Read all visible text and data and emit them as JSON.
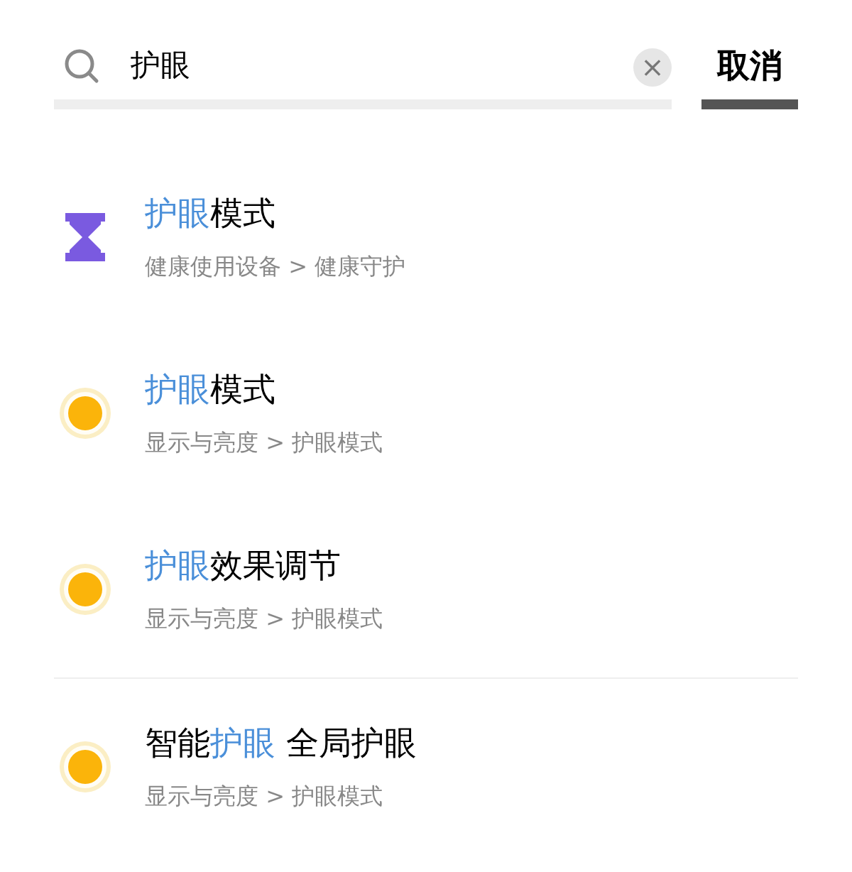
{
  "search": {
    "value": "护眼",
    "clear_label": "×"
  },
  "cancel": "取消",
  "groups": [
    [
      {
        "kind": "hourglass",
        "title": [
          {
            "text": "护眼",
            "match": true
          },
          {
            "text": "模式",
            "match": false
          }
        ],
        "path": "健康使用设备 > 健康守护"
      },
      {
        "kind": "sun",
        "title": [
          {
            "text": "护眼",
            "match": true
          },
          {
            "text": "模式",
            "match": false
          }
        ],
        "path": "显示与亮度 > 护眼模式"
      },
      {
        "kind": "sun",
        "title": [
          {
            "text": "护眼",
            "match": true
          },
          {
            "text": "效果调节",
            "match": false
          }
        ],
        "path": "显示与亮度 > 护眼模式"
      }
    ],
    [
      {
        "kind": "sun",
        "title": [
          {
            "text": "智能",
            "match": false
          },
          {
            "text": "护眼",
            "match": true
          },
          {
            "text": " 全局护眼",
            "match": false
          }
        ],
        "path": "显示与亮度 > 护眼模式"
      }
    ]
  ]
}
